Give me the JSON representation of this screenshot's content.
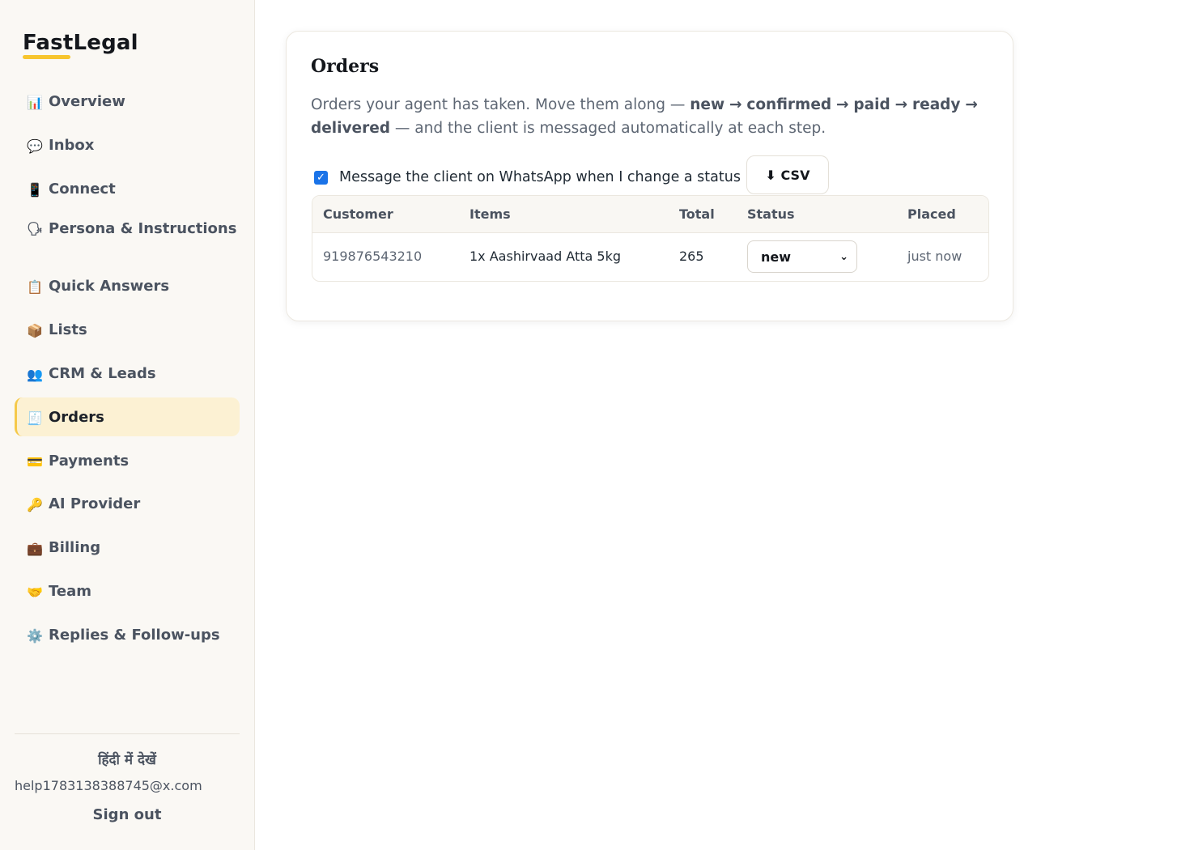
{
  "brand": {
    "name": "FastLegal"
  },
  "nav": [
    {
      "icon": "📊",
      "label": "Overview"
    },
    {
      "icon": "💬",
      "label": "Inbox"
    },
    {
      "icon": "📱",
      "label": "Connect"
    },
    {
      "icon": "🗣",
      "label": "Persona & Instructions"
    },
    {
      "icon": "📋",
      "label": "Quick Answers"
    },
    {
      "icon": "📦",
      "label": "Lists"
    },
    {
      "icon": "👥",
      "label": "CRM & Leads"
    },
    {
      "icon": "🧾",
      "label": "Orders"
    },
    {
      "icon": "💳",
      "label": "Payments"
    },
    {
      "icon": "🔑",
      "label": "AI Provider"
    },
    {
      "icon": "💼",
      "label": "Billing"
    },
    {
      "icon": "🤝",
      "label": "Team"
    },
    {
      "icon": "⚙️",
      "label": "Replies & Follow-ups"
    }
  ],
  "nav_active": "Orders",
  "footer": {
    "language_link": "हिंदी में देखें",
    "email": "help1783138388745@x.com",
    "signout": "Sign out"
  },
  "orders": {
    "title": "Orders",
    "desc_prefix": "Orders your agent has taken. Move them along — ",
    "steps": [
      "new",
      "confirmed",
      "paid",
      "ready",
      "delivered"
    ],
    "arrow": "→",
    "desc_suffix": " — and the client is messaged automatically at each step.",
    "notify_label": "Message the client on WhatsApp when I change a status",
    "notify_checked": true,
    "csv_button": "⬇ CSV",
    "columns": [
      "Customer",
      "Items",
      "Total",
      "Status",
      "Placed"
    ],
    "rows": [
      {
        "customer": "919876543210",
        "items": "1x Aashirvaad Atta 5kg",
        "total": "265",
        "status": "new",
        "placed": "just now"
      }
    ]
  },
  "colors": {
    "accent": "#f7c52e",
    "active_bg": "#fcf1d3",
    "checkbox": "#1a73e8"
  }
}
